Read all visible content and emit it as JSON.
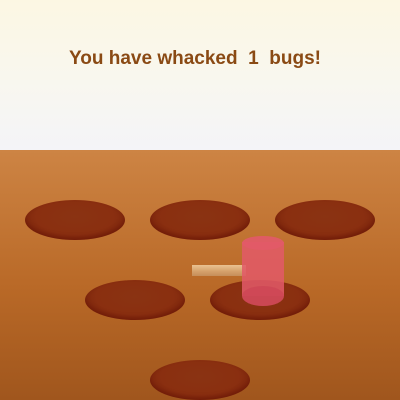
{
  "game": {
    "score_message": "You have whacked  1  bugs!"
  },
  "colors": {
    "score_text": "#8a4a14",
    "dirt": "#b96927",
    "hole": "#8a2f10",
    "mallet_head": "#e25a68",
    "mallet_handle": "#d4a06a"
  },
  "icons": {
    "cursor": "mallet-icon"
  }
}
